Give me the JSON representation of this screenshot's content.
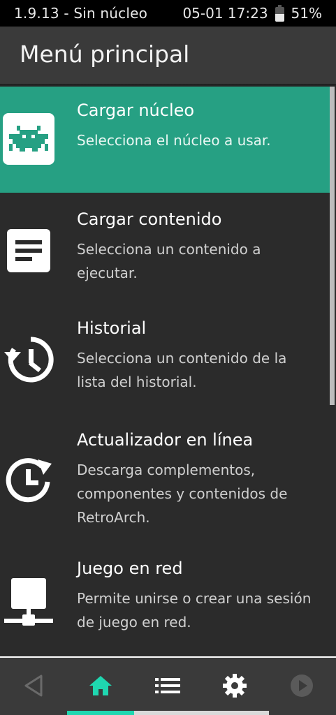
{
  "status_bar": {
    "left_text": "1.9.13 - Sin núcleo",
    "clock": "05-01 17:23",
    "battery_percent": "51%",
    "battery_level": 0.51
  },
  "header": {
    "title": "Menú principal"
  },
  "menu": {
    "items": [
      {
        "label": "Cargar núcleo",
        "description": "Selecciona el núcleo a usar.",
        "icon": "retroarch-invader-icon",
        "selected": true
      },
      {
        "label": "Cargar contenido",
        "description": "Selecciona un contenido a ejecutar.",
        "icon": "document-icon",
        "selected": false
      },
      {
        "label": "Historial",
        "description": "Selecciona un contenido de la lista del historial.",
        "icon": "history-icon",
        "selected": false
      },
      {
        "label": "Actualizador en línea",
        "description": "Descarga complementos, componentes y contenidos de RetroArch.",
        "icon": "clock-update-icon",
        "selected": false
      },
      {
        "label": "Juego en red",
        "description": "Permite unirse o crear una sesión de juego en red.",
        "icon": "network-icon",
        "selected": false
      }
    ]
  },
  "nav": {
    "buttons": [
      {
        "name": "back",
        "icon": "back-triangle-icon",
        "active": false
      },
      {
        "name": "main-menu",
        "icon": "home-icon",
        "active": true
      },
      {
        "name": "playlists",
        "icon": "list-icon",
        "active": false
      },
      {
        "name": "settings",
        "icon": "gear-icon",
        "active": false
      },
      {
        "name": "resume",
        "icon": "play-circle-icon",
        "active": false
      }
    ]
  },
  "colors": {
    "accent": "#26a083",
    "nav_active": "#1fd7b0",
    "background": "#2b2b2b",
    "header": "#3a3a3a"
  }
}
